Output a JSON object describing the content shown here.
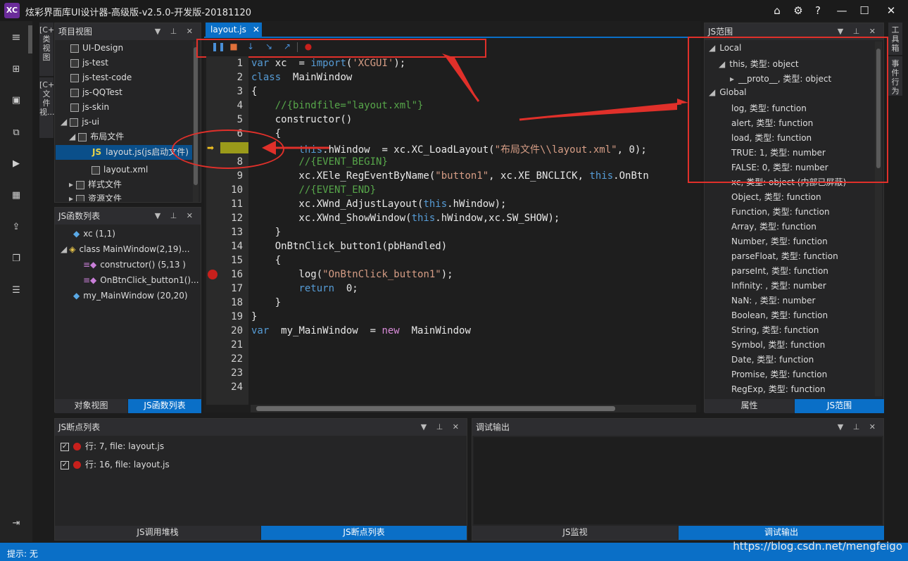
{
  "app": {
    "title": "炫彩界面库UI设计器-高级版-v2.5.0-开发版-20181120",
    "logo": "XC"
  },
  "side_tabs": {
    "left": [
      "[C++]类视图",
      "[C++]文件视..."
    ],
    "right": [
      "工具箱",
      "事件行为"
    ]
  },
  "project_view": {
    "title": "项目视图",
    "items": [
      {
        "label": "UI-Design"
      },
      {
        "label": "js-test"
      },
      {
        "label": "js-test-code"
      },
      {
        "label": "js-QQTest"
      },
      {
        "label": "js-skin"
      },
      {
        "label": "js-ui"
      },
      {
        "label": "布局文件"
      },
      {
        "label": "layout.js(js启动文件)",
        "badge": "JS"
      },
      {
        "label": "layout.xml"
      },
      {
        "label": "样式文件"
      },
      {
        "label": "资源文件"
      }
    ]
  },
  "func_list": {
    "title": "JS函数列表",
    "items": [
      {
        "label": "xc (1,1)"
      },
      {
        "label": "class  MainWindow(2,19)..."
      },
      {
        "label": "constructor() (5,13 )"
      },
      {
        "label": "OnBtnClick_button1()..."
      },
      {
        "label": "my_MainWindow (20,20)"
      }
    ],
    "tabs": [
      "对象视图",
      "JS函数列表"
    ]
  },
  "editor": {
    "tab": "layout.js",
    "line_numbers": [
      "1",
      "2",
      "3",
      "4",
      "5",
      "6",
      "7",
      "8",
      "9",
      "10",
      "11",
      "12",
      "13",
      "14",
      "15",
      "16",
      "17",
      "18",
      "19",
      "20",
      "21",
      "22",
      "23",
      "24"
    ]
  },
  "scope": {
    "title": "JS范围",
    "items": [
      "Local",
      "this,  类型: object",
      "__proto__,  类型: object",
      "Global",
      "log,  类型: function",
      "alert,  类型: function",
      "load,  类型: function",
      "TRUE: 1,  类型: number",
      "FALSE: 0,  类型: number",
      "xc,  类型: object (内部已屏蔽)",
      "Object,  类型: function",
      "Function,  类型: function",
      "Array,  类型: function",
      "Number,  类型: function",
      "parseFloat,  类型: function",
      "parseInt,  类型: function",
      "Infinity: ,  类型: number",
      "NaN: ,  类型: number",
      "Boolean,  类型: function",
      "String,  类型: function",
      "Symbol,  类型: function",
      "Date,  类型: function",
      "Promise,  类型: function",
      "RegExp,  类型: function"
    ],
    "tabs": [
      "属性",
      "JS范围"
    ]
  },
  "breakpoints": {
    "title": "JS断点列表",
    "items": [
      "行: 7,  file: layout.js",
      "行: 16,  file: layout.js"
    ],
    "tabs": [
      "JS调用堆栈",
      "JS断点列表"
    ]
  },
  "debug_output": {
    "title": "调试输出",
    "tabs": [
      "JS监视",
      "调试输出"
    ]
  },
  "status": {
    "text": "提示: 无",
    "watermark": "https://blog.csdn.net/mengfeigo"
  },
  "colors": {
    "accent": "#0a6fc7",
    "annotation": "#e0302a",
    "breakpoint": "#c8201c",
    "keyword": "#569cd6",
    "string": "#d69d85",
    "comment": "#57a64a"
  }
}
